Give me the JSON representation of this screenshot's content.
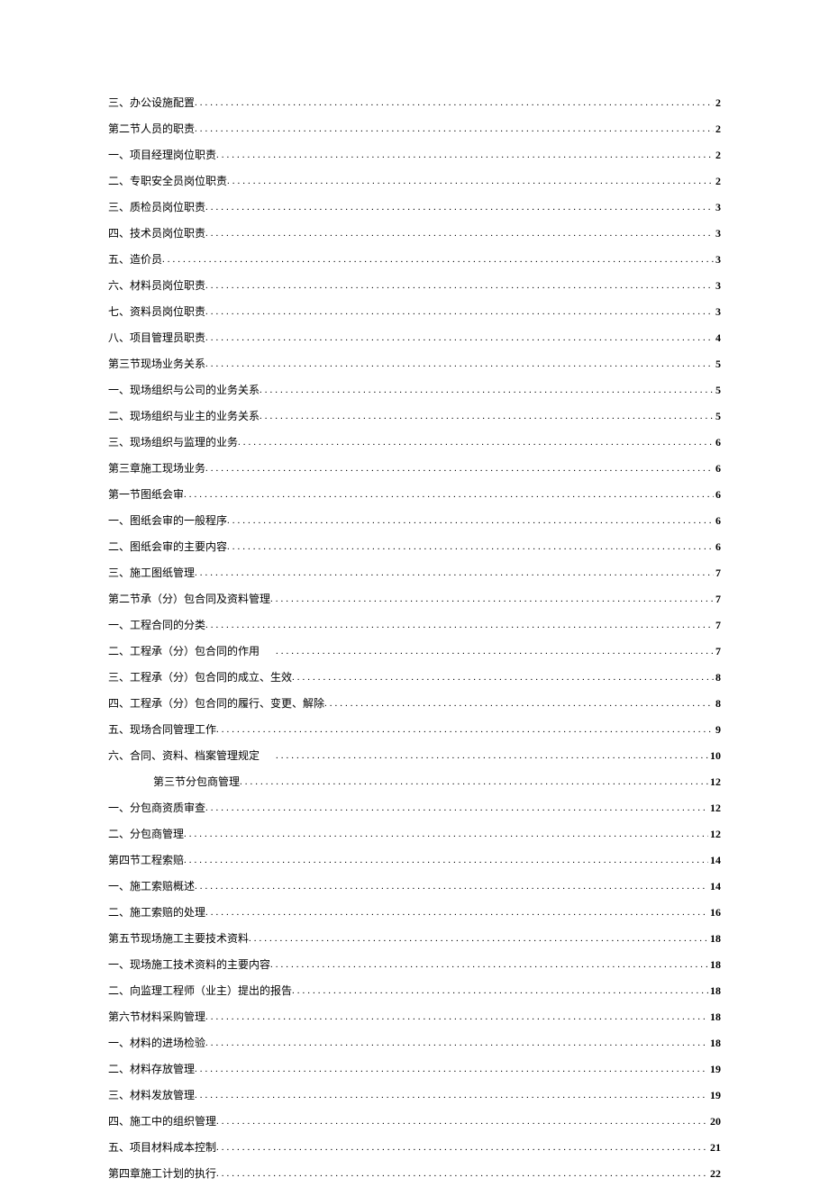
{
  "toc": [
    {
      "title": "三、办公设施配置",
      "page": "2",
      "indent": 1,
      "spacer": false
    },
    {
      "title": "第二节人员的职责",
      "page": "2",
      "indent": 0,
      "spacer": false
    },
    {
      "title": "一、项目经理岗位职责",
      "page": "2",
      "indent": 1,
      "spacer": false
    },
    {
      "title": "二、专职安全员岗位职责",
      "page": "2",
      "indent": 1,
      "spacer": false
    },
    {
      "title": "三、质检员岗位职责",
      "page": "3",
      "indent": 1,
      "spacer": false
    },
    {
      "title": "四、技术员岗位职责",
      "page": "3",
      "indent": 1,
      "spacer": false
    },
    {
      "title": "五、造价员",
      "page": "3",
      "indent": 1,
      "spacer": false
    },
    {
      "title": "六、材料员岗位职责",
      "page": "3",
      "indent": 1,
      "spacer": false
    },
    {
      "title": "七、资料员岗位职责",
      "page": "3",
      "indent": 1,
      "spacer": false
    },
    {
      "title": "八、项目管理员职责",
      "page": "4",
      "indent": 1,
      "spacer": false
    },
    {
      "title": "第三节现场业务关系",
      "page": "5",
      "indent": 0,
      "spacer": false
    },
    {
      "title": "一、现场组织与公司的业务关系",
      "page": "5",
      "indent": 1,
      "spacer": false
    },
    {
      "title": "二、现场组织与业主的业务关系",
      "page": "5",
      "indent": 1,
      "spacer": false
    },
    {
      "title": "三、现场组织与监理的业务",
      "page": "6",
      "indent": 1,
      "spacer": false
    },
    {
      "title": "第三章施工现场业务",
      "page": "6",
      "indent": 0,
      "spacer": false
    },
    {
      "title": "第一节图纸会审",
      "page": "6",
      "indent": 0,
      "spacer": false
    },
    {
      "title": "一、图纸会审的一般程序",
      "page": "6",
      "indent": 1,
      "spacer": false
    },
    {
      "title": "二、图纸会审的主要内容",
      "page": "6",
      "indent": 1,
      "spacer": false
    },
    {
      "title": "三、施工图纸管理",
      "page": "7",
      "indent": 1,
      "spacer": false
    },
    {
      "title": "第二节承（分）包合同及资料管理",
      "page": "7",
      "indent": 0,
      "spacer": false
    },
    {
      "title": "一、工程合同的分类",
      "page": "7",
      "indent": 1,
      "spacer": false
    },
    {
      "title": "二、工程承（分）包合同的作用",
      "page": "7",
      "indent": 1,
      "spacer": true
    },
    {
      "title": "三、工程承（分）包合同的成立、生效",
      "page": "8",
      "indent": 1,
      "spacer": false
    },
    {
      "title": "四、工程承（分）包合同的履行、变更、解除",
      "page": "8",
      "indent": 1,
      "spacer": false
    },
    {
      "title": "五、现场合同管理工作",
      "page": "9",
      "indent": 1,
      "spacer": false
    },
    {
      "title": "六、合同、资料、档案管理规定",
      "page": "10",
      "indent": 1,
      "spacer": true
    },
    {
      "title": "第三节分包商管理",
      "page": "12",
      "indent": 2,
      "spacer": false
    },
    {
      "title": "一、分包商资质审查",
      "page": "12",
      "indent": 1,
      "spacer": false
    },
    {
      "title": "二、分包商管理",
      "page": "12",
      "indent": 1,
      "spacer": false
    },
    {
      "title": "第四节工程索赔",
      "page": "14",
      "indent": 0,
      "spacer": false
    },
    {
      "title": "一、施工索赔概述",
      "page": "14",
      "indent": 1,
      "spacer": false
    },
    {
      "title": "二、施工索赔的处理",
      "page": "16",
      "indent": 1,
      "spacer": false
    },
    {
      "title": "第五节现场施工主要技术资料",
      "page": "18",
      "indent": 0,
      "spacer": false
    },
    {
      "title": "一、现场施工技术资料的主要内容",
      "page": "18",
      "indent": 1,
      "spacer": false
    },
    {
      "title": "二、向监理工程师（业主）提出的报告",
      "page": "18",
      "indent": 1,
      "spacer": false
    },
    {
      "title": "第六节材料采购管理",
      "page": "18",
      "indent": 0,
      "spacer": false
    },
    {
      "title": "一、材料的进场检验",
      "page": "18",
      "indent": 1,
      "spacer": false
    },
    {
      "title": "二、材料存放管理",
      "page": "19",
      "indent": 1,
      "spacer": false
    },
    {
      "title": "三、材料发放管理",
      "page": "19",
      "indent": 1,
      "spacer": false
    },
    {
      "title": "四、施工中的组织管理",
      "page": "20",
      "indent": 1,
      "spacer": false
    },
    {
      "title": "五、项目材料成本控制",
      "page": "21",
      "indent": 1,
      "spacer": false
    },
    {
      "title": "第四章施工计划的执行",
      "page": "22",
      "indent": 0,
      "spacer": false
    }
  ]
}
